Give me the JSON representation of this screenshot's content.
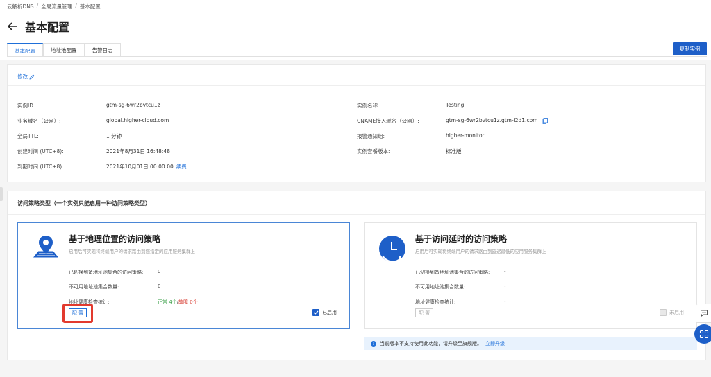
{
  "breadcrumb": {
    "items": [
      "云解析DNS",
      "全局流量管理",
      "基本配置"
    ],
    "sep": "/"
  },
  "header": {
    "title": "基本配置"
  },
  "tabs": [
    {
      "label": "基本配置",
      "active": true
    },
    {
      "label": "地址池配置",
      "active": false
    },
    {
      "label": "告警日志",
      "active": false
    }
  ],
  "toolbar": {
    "copy_instance_label": "复制实例"
  },
  "info": {
    "edit_label": "修改",
    "left": [
      {
        "key": "实例ID:",
        "value": "gtm-sg-6wr2bvtcu1z"
      },
      {
        "key": "业务域名（公网）:",
        "value": "global.higher-cloud.com"
      },
      {
        "key": "全局TTL:",
        "value": "1 分钟"
      },
      {
        "key": "创建时间 (UTC+8):",
        "value": "2021年8月31日 16:48:48"
      },
      {
        "key": "到期时间 (UTC+8):",
        "value": "2021年10月01日 00:00:00"
      }
    ],
    "renew_label": "续费",
    "right": [
      {
        "key": "实例名称:",
        "value": "Testing"
      },
      {
        "key": "CNAME接入域名（公网）:",
        "value": "gtm-sg-6wr2bvtcu1z.gtm-i2d1.com"
      },
      {
        "key": "报警通知组:",
        "value": "higher-monitor"
      },
      {
        "key": "实例套餐版本:",
        "value": "标准版"
      }
    ]
  },
  "policy": {
    "section_title": "访问策略类型（一个实例只能启用一种访问策略类型）",
    "geo": {
      "title": "基于地理位置的访问策略",
      "desc": "启用后可实现将终端用户的请求路由到您指定的应用服务集群上",
      "rows": [
        {
          "key": "已切换到备地址池集合的访问策略:",
          "value": "0"
        },
        {
          "key": "不可用地址池集合数量:",
          "value": "0"
        },
        {
          "key": "地址健康检查统计:",
          "ok": "正常 4个",
          "slash": "/",
          "fail": "故障 0个"
        }
      ],
      "config_label": "配 置",
      "enabled_label": "已启用"
    },
    "latency": {
      "title": "基于访问延时的访问策略",
      "desc": "启用后可实现将终端用户的请求路由到延迟最低的应用服务集群上",
      "rows": [
        {
          "key": "已切换到备地址池集合的访问策略:",
          "value": "-"
        },
        {
          "key": "不可用地址池集合数量:",
          "value": "-"
        },
        {
          "key": "地址健康检查统计:",
          "value": "-"
        }
      ],
      "config_label": "配 置",
      "enabled_label": "未启用"
    },
    "notice": {
      "text": "当前版本不支持使用此功能，请升级至旗舰版。",
      "link": "立即升级"
    }
  },
  "colors": {
    "primary": "#1e5fc8",
    "link": "#1e6fd9",
    "highlight": "#e23a2e",
    "ok": "#2e9a3c",
    "fail": "#d9453b"
  }
}
